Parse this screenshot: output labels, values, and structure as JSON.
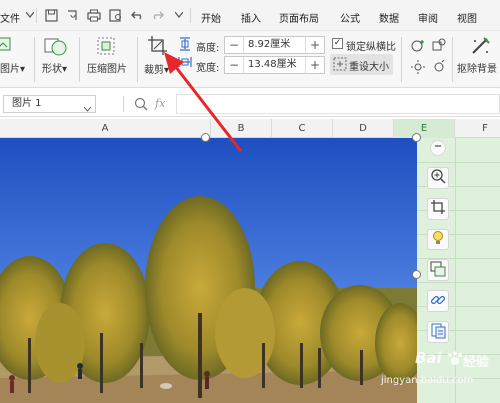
{
  "menubar": {
    "file_label": "文件",
    "tabs": [
      "开始",
      "插入",
      "页面布局",
      "公式",
      "数据",
      "审阅",
      "视图"
    ]
  },
  "ribbon": {
    "picture_label": "图片",
    "shape_label": "形状",
    "compress_label": "压缩图片",
    "crop_label": "裁剪",
    "height_label": "高度:",
    "height_value": "8.92厘米",
    "width_label": "宽度:",
    "width_value": "13.48厘米",
    "lock_ratio_label": "锁定纵横比",
    "lock_ratio_checked": true,
    "reset_size_label": "重设大小",
    "remove_bg_label": "抠除背景"
  },
  "formula_bar": {
    "name_box": "图片 1",
    "fx_label": "fx"
  },
  "columns": [
    "A",
    "B",
    "C",
    "D",
    "E",
    "F"
  ],
  "watermark": {
    "line1": "Bai",
    "line2": "经验",
    "line3": "jingyan.baidu.com"
  },
  "icons": {
    "zoom_out": "minus-circle-icon",
    "zoom_in": "zoom-in-icon",
    "crop": "crop-icon",
    "bulb": "lightbulb-icon",
    "picture_swap": "picture-swap-icon",
    "link": "link-icon",
    "doc": "document-icon"
  },
  "colors": {
    "accent": "#2b7a3d",
    "arrow": "#e8262b",
    "green_zone": "#dff0dc",
    "sky": "#3f6fd4"
  }
}
